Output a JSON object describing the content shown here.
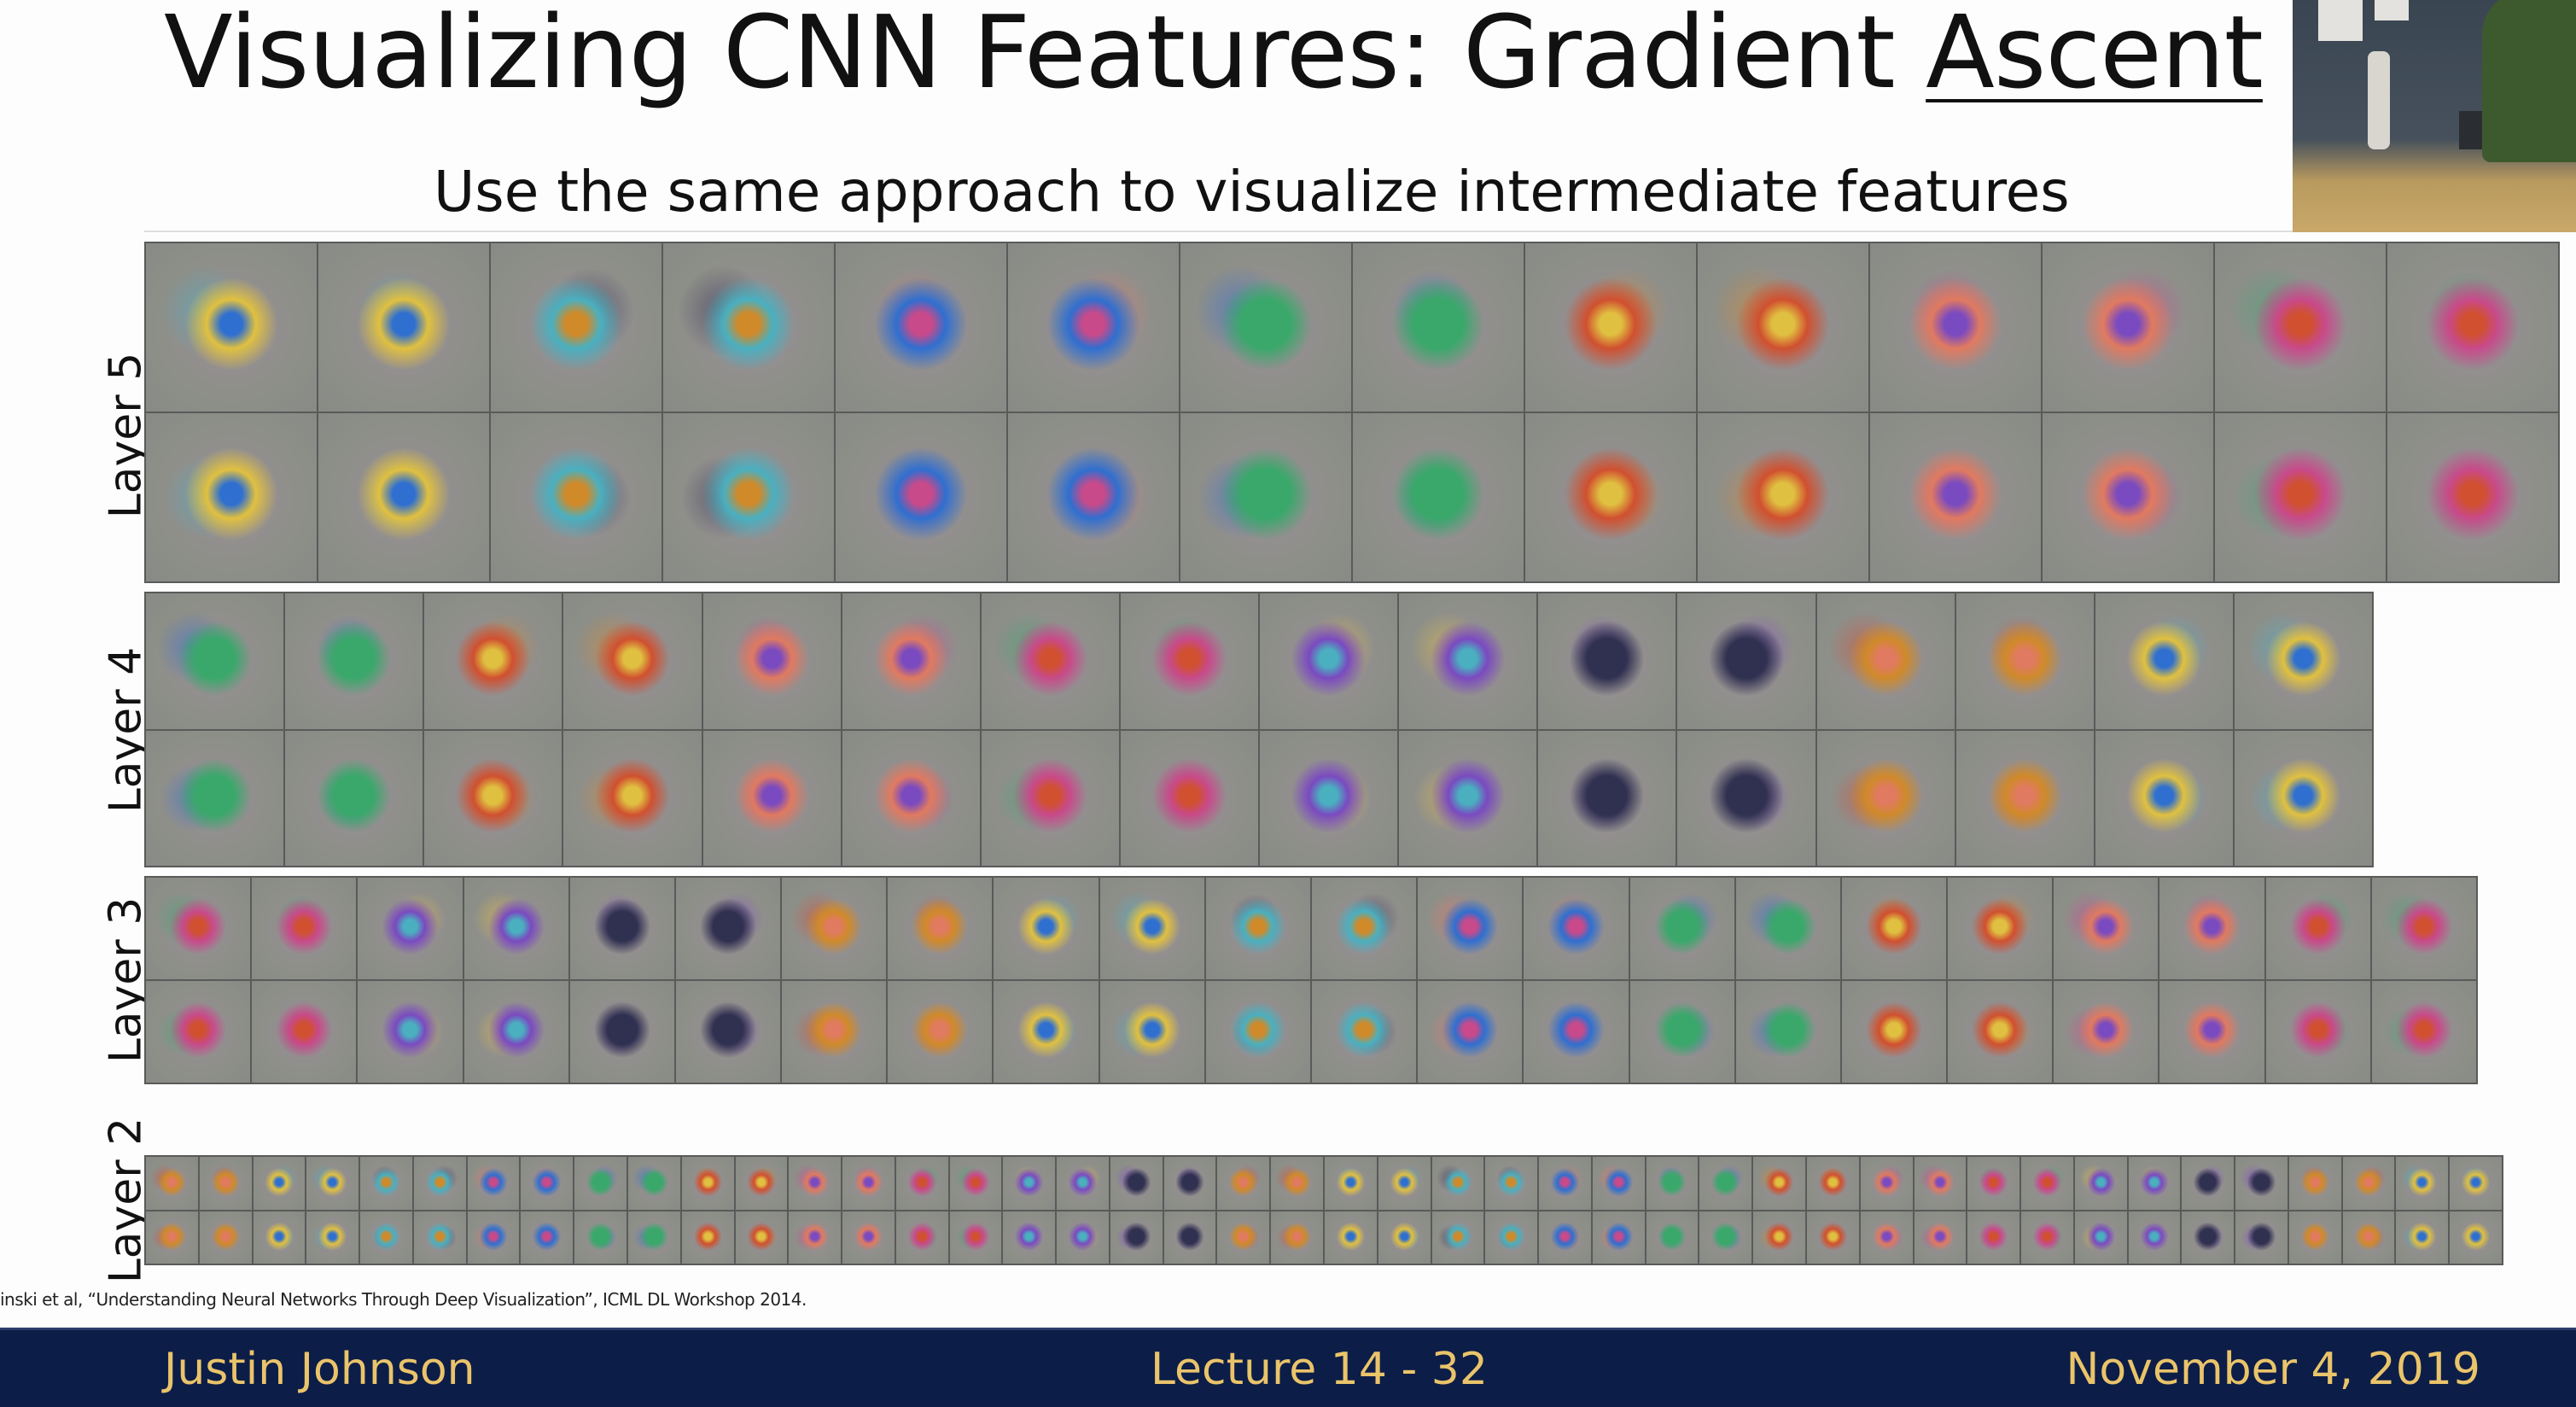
{
  "slide": {
    "title_main": "Visualizing CNN Features: Gradient ",
    "title_underlined": "Ascent",
    "subtitle": "Use the same approach to visualize intermediate features",
    "citation": "inski et al, “Understanding Neural Networks Through Deep Visualization”, ICML DL Workshop 2014."
  },
  "layers": [
    {
      "label": "Layer 5",
      "columns": 14,
      "rows": 2
    },
    {
      "label": "Layer 4",
      "columns": 16,
      "rows": 2
    },
    {
      "label": "Layer 3",
      "columns": 22,
      "rows": 2
    },
    {
      "label": "Layer 2",
      "columns": 44,
      "rows": 2
    }
  ],
  "footer": {
    "author": "Justin Johnson",
    "lecture": "Lecture 14 - 32",
    "date": "November 4, 2019",
    "background_color": "#0c1d48",
    "text_color": "#eac46a"
  }
}
